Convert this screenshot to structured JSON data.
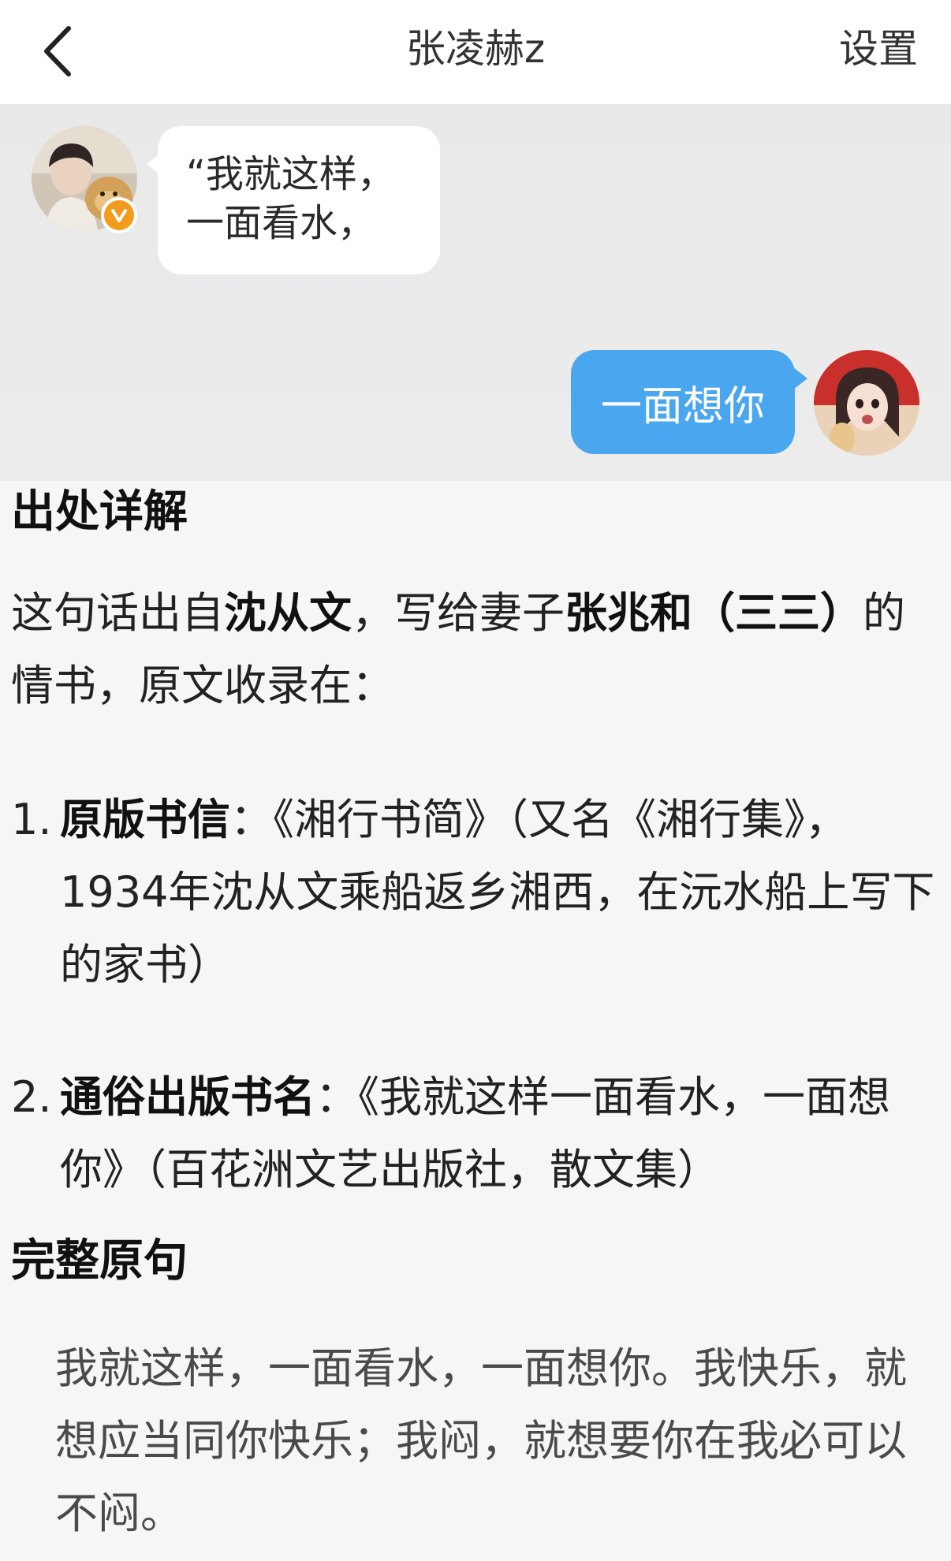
{
  "header": {
    "title": "张凌赫z",
    "settings_label": "设置"
  },
  "chat": {
    "left_message_lines": [
      "“我就这样，",
      "一面看水，"
    ],
    "right_message": "一面想你",
    "verify_badge": "V"
  },
  "article": {
    "section1_title": "出处详解",
    "intro": {
      "part1": "这句话出自",
      "author": "沈从文",
      "part2": "，写给妻子",
      "recipient": "张兆和（三三）",
      "part3": "的情书，原文收录在："
    },
    "items": [
      {
        "num": "1.",
        "label": "原版书信",
        "text": "：《湘行书简》（又名《湘行集》，1934年沈从文乘船返乡湘西，在沅水船上写下的家书）"
      },
      {
        "num": "2.",
        "label": "通俗出版书名",
        "text": "：《我就这样一面看水，一面想你》（百花洲文艺出版社，散文集）"
      }
    ],
    "section2_title": "完整原句",
    "quote_text": "我就这样，一面看水，一面想你。我快乐，就想应当同你快乐；我闷，就想要你在我必可以不闷。"
  },
  "colors": {
    "header_bg": "#ffffff",
    "chat_bg": "#eaeaeb",
    "bubble_right": "#4aa6ef",
    "badge": "#f29b1c",
    "page_bg": "#f6f6f6"
  },
  "icons": {
    "back": "chevron-left-icon",
    "badge": "verified-badge-icon"
  }
}
